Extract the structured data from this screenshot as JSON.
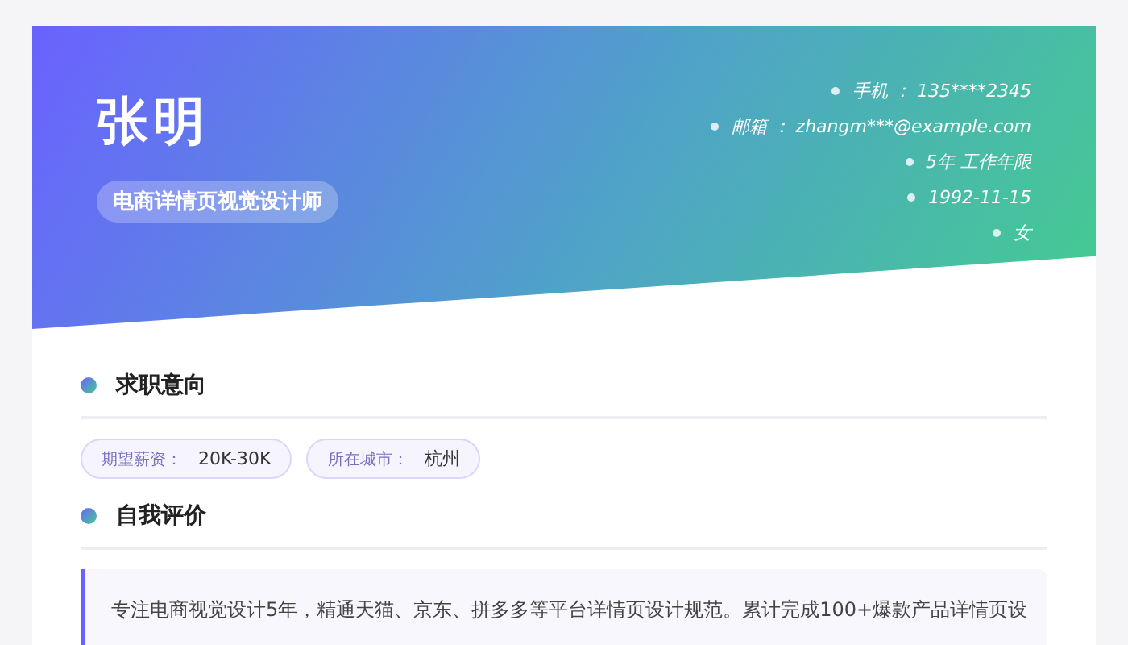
{
  "header": {
    "name": "张明",
    "title": "电商详情页视觉设计师",
    "contacts": [
      "手机 ：  135****2345",
      "邮箱 ：  zhangm***@example.com",
      "5年  工作年限",
      "1992-11-15",
      "女"
    ]
  },
  "sections": [
    {
      "kind": "tags",
      "heading": "求职意向",
      "tags": [
        {
          "label": "期望薪资：",
          "value": "20K-30K"
        },
        {
          "label": "所在城市：",
          "value": "杭州"
        }
      ]
    },
    {
      "kind": "text",
      "heading": "自我评价",
      "text": "专注电商视觉设计5年，精通天猫、京东、拼多多等平台详情页设计规范。累计完成100+爆款产品详情页设"
    }
  ]
}
